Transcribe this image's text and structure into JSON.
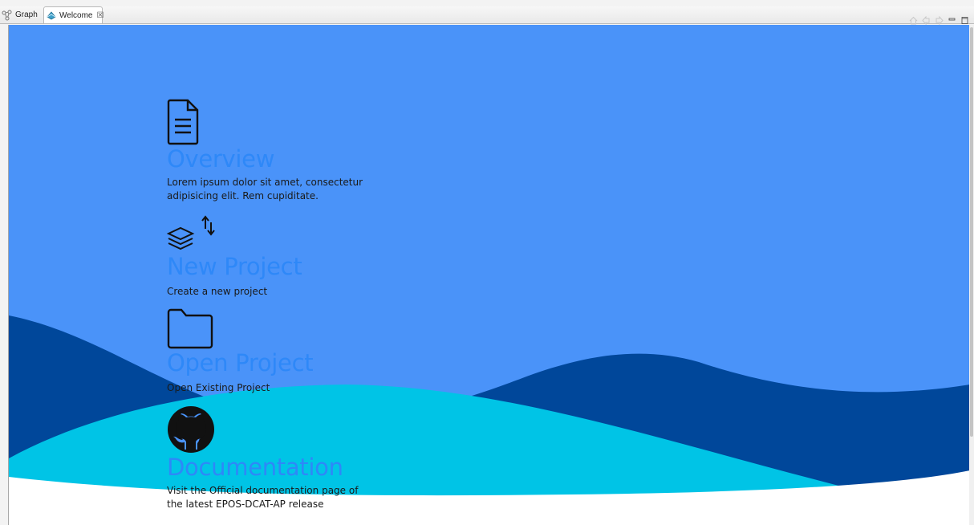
{
  "tabs": [
    {
      "label": "Graph",
      "icon": "graph-icon",
      "active": false
    },
    {
      "label": "Welcome",
      "icon": "welcome-icon",
      "active": true,
      "close": "☒"
    }
  ],
  "toolbar": {
    "icons": [
      "home-icon",
      "back-icon",
      "forward-icon",
      "minimize-icon",
      "maximize-icon"
    ]
  },
  "welcome": {
    "items": [
      {
        "icon": "document-icon",
        "title": "Overview",
        "description": "Lorem ipsum dolor sit amet, consectetur adipisicing elit. Rem cupiditate."
      },
      {
        "icon": "layers-icon",
        "title": "New Project",
        "description": "Create a new project"
      },
      {
        "icon": "folder-icon",
        "title": "Open Project",
        "description": "Open Existing Project"
      },
      {
        "icon": "github-icon",
        "title": "Documentation",
        "description": "Visit the Official documentation page of the latest EPOS-DCAT-AP release"
      }
    ]
  },
  "colors": {
    "background_blue": "#4a93f9",
    "wave_dark": "#00479a",
    "wave_cyan": "#00c4e6",
    "title_blue": "#2e88f8"
  }
}
